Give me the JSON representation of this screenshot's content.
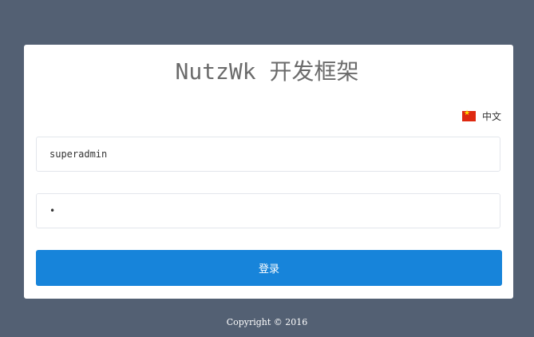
{
  "app": {
    "title": "NutzWk 开发框架"
  },
  "language": {
    "selected": "中文",
    "flag_icon": "china-flag-icon"
  },
  "login_form": {
    "username_value": "superadmin",
    "password_value": "*",
    "submit_label": "登录"
  },
  "footer": {
    "copyright": "Copyright © 2016"
  },
  "colors": {
    "background": "#536073",
    "primary_button": "#1784da",
    "card": "#ffffff"
  }
}
